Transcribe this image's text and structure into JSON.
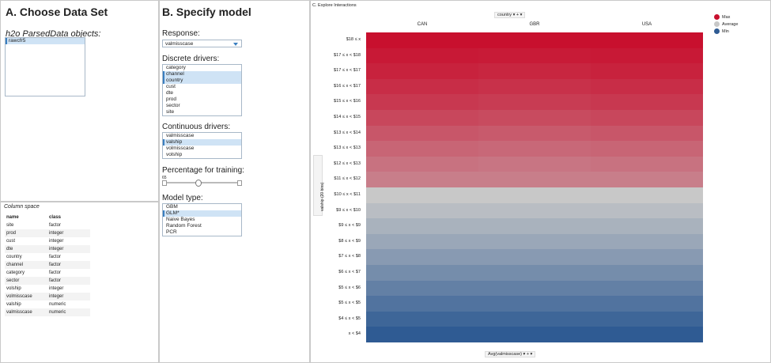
{
  "panelA": {
    "title": "A. Choose Data Set",
    "subtitle": "h2o ParsedData objects:",
    "items": [
      "rawcfr5"
    ]
  },
  "colspace": {
    "title": "Column space",
    "headers": [
      "name",
      "class"
    ],
    "rows": [
      [
        "site",
        "factor"
      ],
      [
        "prod",
        "integer"
      ],
      [
        "cust",
        "integer"
      ],
      [
        "dte",
        "integer"
      ],
      [
        "country",
        "factor"
      ],
      [
        "channel",
        "factor"
      ],
      [
        "category",
        "factor"
      ],
      [
        "sector",
        "factor"
      ],
      [
        "volship",
        "integer"
      ],
      [
        "volmisscase",
        "integer"
      ],
      [
        "valship",
        "numeric"
      ],
      [
        "valmisscase",
        "numeric"
      ]
    ]
  },
  "panelB": {
    "title": "B. Specify model",
    "response_label": "Response:",
    "response_value": "valmisscase",
    "discrete_label": "Discrete drivers:",
    "discrete_items": [
      {
        "label": "category",
        "sel": false
      },
      {
        "label": "channel",
        "sel": true
      },
      {
        "label": "country",
        "sel": true
      },
      {
        "label": "cust",
        "sel": false
      },
      {
        "label": "dte",
        "sel": false
      },
      {
        "label": "prod",
        "sel": false
      },
      {
        "label": "sector",
        "sel": false
      },
      {
        "label": "site",
        "sel": false
      }
    ],
    "continuous_label": "Continuous drivers:",
    "continuous_items": [
      {
        "label": "valmisscase",
        "sel": false
      },
      {
        "label": "valship",
        "sel": true
      },
      {
        "label": "volmisscase",
        "sel": false
      },
      {
        "label": "volship",
        "sel": false
      }
    ],
    "training_label": "Percentage for training:",
    "training_value": "65",
    "model_label": "Model type:",
    "model_items": [
      {
        "label": "GBM",
        "sel": false
      },
      {
        "label": "GLM*",
        "sel": true
      },
      {
        "label": "Naive Bayes",
        "sel": false
      },
      {
        "label": "Random Forest",
        "sel": false
      },
      {
        "label": "PCR",
        "sel": false
      }
    ]
  },
  "panelC": {
    "title": "C. Explore Interactions",
    "col_pill": "country",
    "row_pill": "valship (20 bins)",
    "bottom_pill": "Avg(valmisscase)",
    "legend": [
      {
        "label": "Max",
        "color": "#c8102e"
      },
      {
        "label": "Average",
        "color": "#c8c8c8"
      },
      {
        "label": "Min",
        "color": "#2f5b93"
      }
    ]
  },
  "chart_data": {
    "type": "heatmap",
    "title": "C. Explore Interactions",
    "columns": [
      "CAN",
      "GBR",
      "USA"
    ],
    "rows": [
      "$18 ≤ x",
      "$17 ≤ x < $18",
      "$17 ≤ x < $17",
      "$16 ≤ x < $17",
      "$15 ≤ x < $16",
      "$14 ≤ x < $15",
      "$13 ≤ x < $14",
      "$13 ≤ x < $13",
      "$12 ≤ x < $13",
      "$11 ≤ x < $12",
      "$10 ≤ x < $11",
      "$9 ≤ x < $10",
      "$9 ≤ x < $9",
      "$8 ≤ x < $9",
      "$7 ≤ x < $8",
      "$6 ≤ x < $7",
      "$5 ≤ x < $6",
      "$5 ≤ x < $5",
      "$4 ≤ x < $5",
      "x < $4"
    ],
    "values": [
      [
        1.0,
        1.0,
        1.0
      ],
      [
        0.95,
        0.94,
        0.95
      ],
      [
        0.9,
        0.88,
        0.9
      ],
      [
        0.84,
        0.82,
        0.84
      ],
      [
        0.78,
        0.76,
        0.78
      ],
      [
        0.7,
        0.68,
        0.7
      ],
      [
        0.62,
        0.6,
        0.62
      ],
      [
        0.54,
        0.52,
        0.54
      ],
      [
        0.47,
        0.45,
        0.47
      ],
      [
        0.4,
        0.4,
        0.4
      ],
      [
        0.0,
        0.0,
        0.0
      ],
      [
        -0.1,
        -0.1,
        -0.1
      ],
      [
        -0.2,
        -0.2,
        -0.2
      ],
      [
        -0.3,
        -0.3,
        -0.3
      ],
      [
        -0.42,
        -0.42,
        -0.42
      ],
      [
        -0.54,
        -0.54,
        -0.54
      ],
      [
        -0.66,
        -0.66,
        -0.66
      ],
      [
        -0.78,
        -0.78,
        -0.78
      ],
      [
        -0.9,
        -0.9,
        -0.9
      ],
      [
        -1.0,
        -1.0,
        -1.0
      ]
    ],
    "xlabel": "country",
    "ylabel": "valship (20 bins)",
    "measure": "Avg(valmisscase)",
    "legend": [
      "Max",
      "Average",
      "Min"
    ]
  }
}
